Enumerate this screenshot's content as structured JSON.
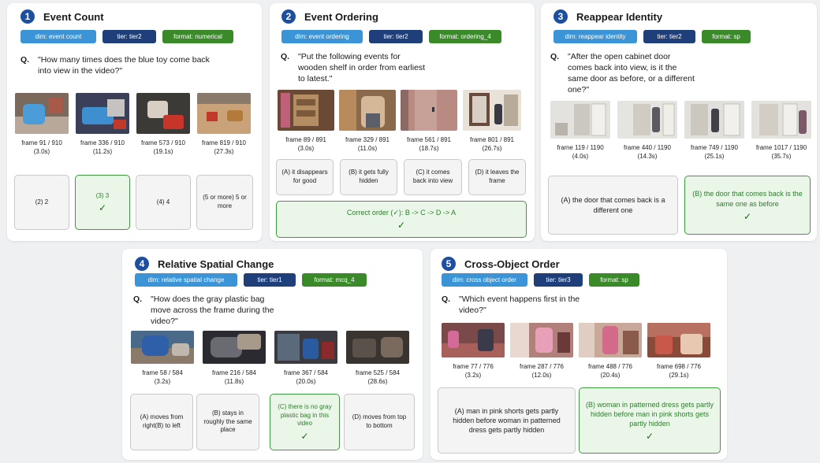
{
  "colors": {
    "dim": "#3b94d6",
    "tier": "#1f3f7a",
    "format": "#3a8a2a",
    "number_badge": "#1d4fa0",
    "correct_border": "#3e9a3e"
  },
  "panels": [
    {
      "number": "1",
      "title": "Event Count",
      "tags": {
        "dim": "dim: event count",
        "tier": "tier: tier2",
        "format": "format: numerical"
      },
      "q_label": "Q.",
      "question": "\"How many times does the blue toy come back into view in the video?\"",
      "frames": [
        {
          "label": "frame 91 / 910",
          "time": "(3.0s)"
        },
        {
          "label": "frame 336 / 910",
          "time": "(11.2s)"
        },
        {
          "label": "frame 573 / 910",
          "time": "(19.1s)"
        },
        {
          "label": "frame 819 / 910",
          "time": "(27.3s)"
        }
      ],
      "options": [
        {
          "text": "(2) 2"
        },
        {
          "text": "(3) 3",
          "check": "✓"
        },
        {
          "text": "(4) 4"
        },
        {
          "text": "(5 or more) 5 or more"
        }
      ]
    },
    {
      "number": "2",
      "title": "Event Ordering",
      "tags": {
        "dim": "dim: event ordering",
        "tier": "tier: tier2",
        "format": "format: ordering_4"
      },
      "q_label": "Q.",
      "question": "\"Put the following events for wooden shelf in order from earliest to latest.\"",
      "frames": [
        {
          "label": "frame 89 / 891",
          "time": "(3.0s)"
        },
        {
          "label": "frame 329 / 891",
          "time": "(11.0s)"
        },
        {
          "label": "frame 561 / 891",
          "time": "(18.7s)"
        },
        {
          "label": "frame 801 / 891",
          "time": "(26.7s)"
        }
      ],
      "options": [
        {
          "text": "(A) it disappears for good"
        },
        {
          "text": "(B) it gets fully hidden"
        },
        {
          "text": "(C) it comes back into view"
        },
        {
          "text": "(D) it leaves the frame"
        }
      ],
      "order_text": "Correct order (✓): B -> C -> D -> A",
      "order_check": "✓"
    },
    {
      "number": "3",
      "title": "Reappear Identity",
      "tags": {
        "dim": "dim: reappear identity",
        "tier": "tier: tier2",
        "format": "format: sp"
      },
      "q_label": "Q.",
      "question": "\"After the open cabinet door comes back into view, is it the same door as before, or a different one?\"",
      "frames": [
        {
          "label": "frame 119 / 1190",
          "time": "(4.0s)"
        },
        {
          "label": "frame 440 / 1190",
          "time": "(14.3s)"
        },
        {
          "label": "frame 749 / 1190",
          "time": "(25.1s)"
        },
        {
          "label": "frame 1017 / 1190",
          "time": "(35.7s)"
        }
      ],
      "options": [
        {
          "text": "(A) the door that comes back is a different one"
        },
        {
          "text": "(B) the door that comes back is the same one as before",
          "check": "✓"
        }
      ]
    },
    {
      "number": "4",
      "title": "Relative Spatial Change",
      "tags": {
        "dim": "dim: relative spatial change",
        "tier": "tier: tier1",
        "format": "format: mcq_4"
      },
      "q_label": "Q.",
      "question": "\"How does the gray plastic bag move across the frame during the video?\"",
      "frames": [
        {
          "label": "frame 58 / 584",
          "time": "(3.2s)"
        },
        {
          "label": "frame 216 / 584",
          "time": "(11.8s)"
        },
        {
          "label": "frame 367 / 584",
          "time": "(20.0s)"
        },
        {
          "label": "frame 525 / 584",
          "time": "(28.6s)"
        }
      ],
      "options": [
        {
          "text": "(A) moves from right(B) to left"
        },
        {
          "text": "(B) stays in roughly the same place"
        },
        {
          "text": "(C) there is no gray plastic bag in this video",
          "check": "✓"
        },
        {
          "text": "(D) moves from top to bottom"
        }
      ]
    },
    {
      "number": "5",
      "title": "Cross-Object Order",
      "tags": {
        "dim": "dim: cross object order",
        "tier": "tier: tier3",
        "format": "format: sp"
      },
      "q_label": "Q.",
      "question": "\"Which event happens first in the video?\"",
      "frames": [
        {
          "label": "frame 77 / 776",
          "time": "(3.2s)"
        },
        {
          "label": "frame 287 / 776",
          "time": "(12.0s)"
        },
        {
          "label": "frame 488 / 776",
          "time": "(20.4s)"
        },
        {
          "label": "frame 698 / 776",
          "time": "(29.1s)"
        }
      ],
      "options": [
        {
          "text": "(A) man in pink shorts gets partly hidden before woman in patterned dress gets partly hidden"
        },
        {
          "text": "(B) woman in patterned dress gets partly hidden before man in pink shorts gets partly hidden",
          "check": "✓"
        }
      ]
    }
  ]
}
